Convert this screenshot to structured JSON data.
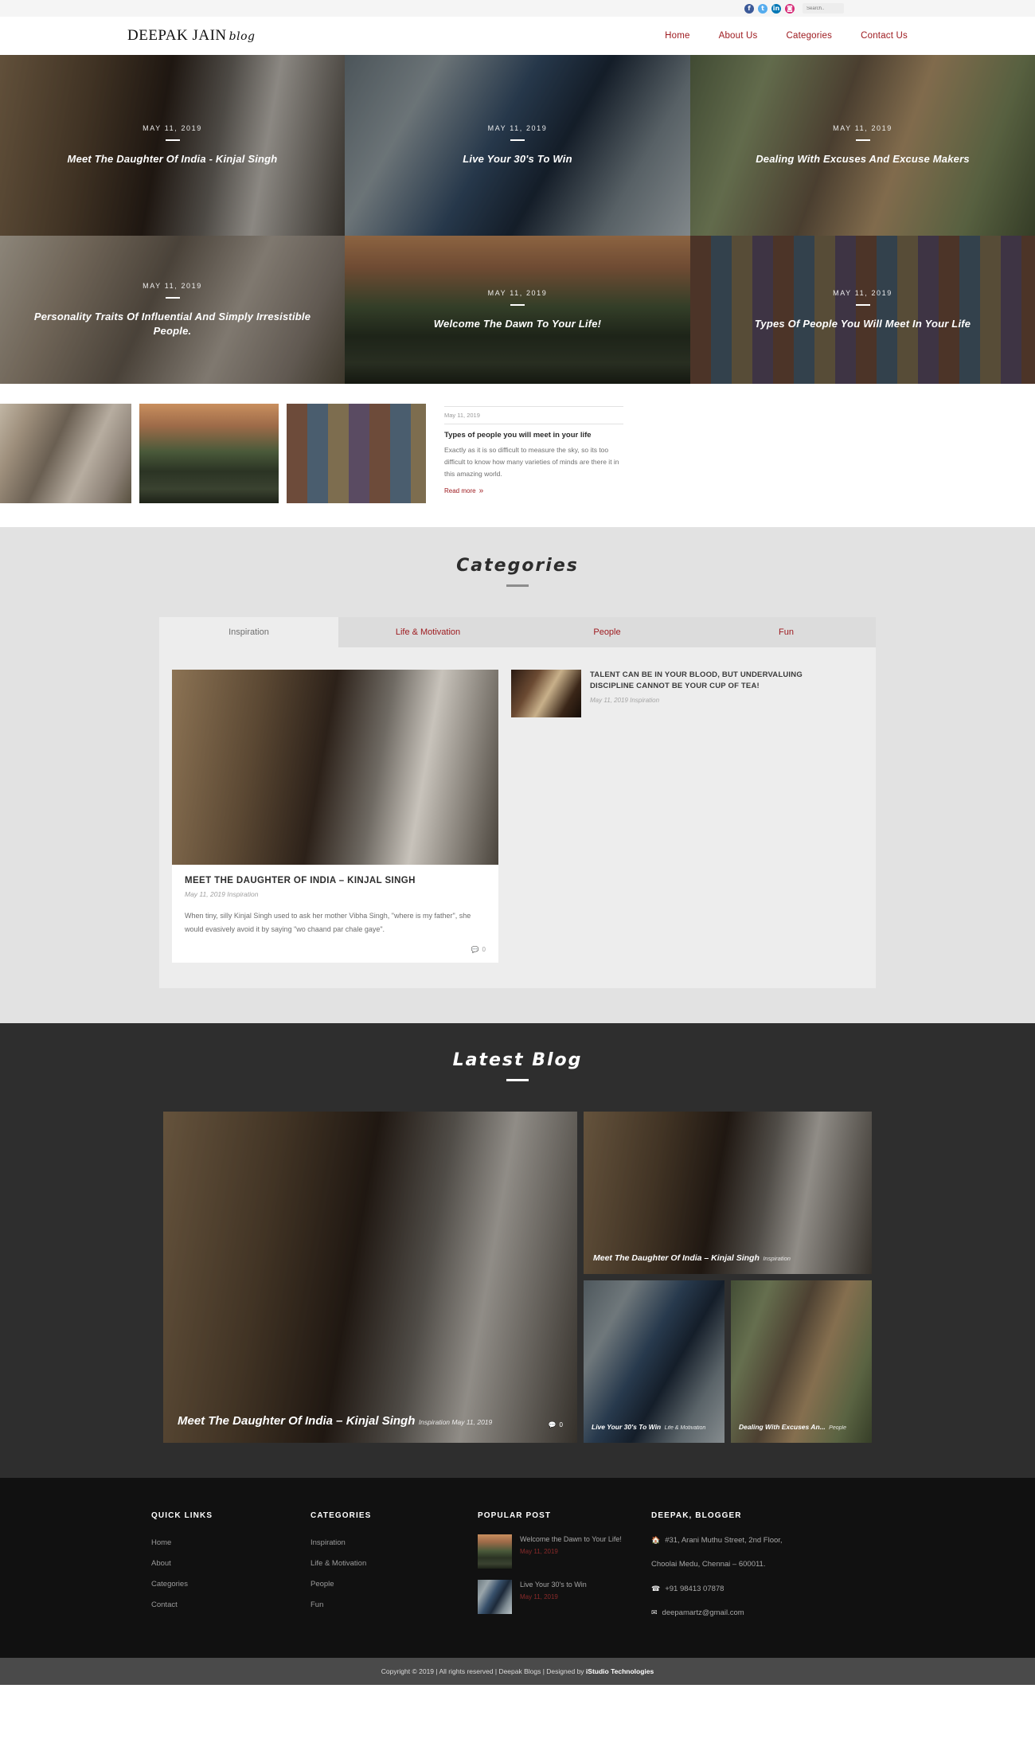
{
  "topbar": {
    "social": [
      {
        "name": "facebook-icon",
        "glyph": "f"
      },
      {
        "name": "twitter-icon",
        "glyph": "t"
      },
      {
        "name": "linkedin-icon",
        "glyph": "in"
      },
      {
        "name": "instagram-icon",
        "glyph": "◙"
      }
    ],
    "search_placeholder": "Search..",
    "search_value": ""
  },
  "nav": {
    "logo": "DEEPAK JAIN",
    "logo_suffix": "blog",
    "links": [
      {
        "label": "Home"
      },
      {
        "label": "About Us"
      },
      {
        "label": "Categories"
      },
      {
        "label": "Contact Us"
      }
    ],
    "accent": "#9e1b20"
  },
  "hero": {
    "tiles": [
      {
        "date": "MAY 11, 2019",
        "title": "Meet The Daughter Of India - Kinjal Singh",
        "img": "img-kinjal"
      },
      {
        "date": "MAY 11, 2019",
        "title": "Live Your 30's To Win",
        "img": "img-30s"
      },
      {
        "date": "MAY 11, 2019",
        "title": "Dealing With Excuses And Excuse Makers",
        "img": "img-excuses"
      },
      {
        "date": "MAY 11, 2019",
        "title": "Personality Traits Of Influential And Simply Irresistible People.",
        "img": "img-person"
      },
      {
        "date": "MAY 11, 2019",
        "title": "Welcome The Dawn To Your Life!",
        "img": "img-dawn"
      },
      {
        "date": "MAY 11, 2019",
        "title": "Types Of People You Will Meet In Your Life",
        "img": "img-types"
      }
    ]
  },
  "strip": {
    "thumbs": [
      "img-person",
      "img-dawn",
      "img-types"
    ],
    "excerpt": {
      "date": "May 11, 2019",
      "title": "Types of people you will meet in your life",
      "body": "Exactly as it is so difficult to measure the sky, so its too difficult to know how many varieties of minds are there it in this amazing world.",
      "read_more": "Read more"
    }
  },
  "categories": {
    "heading": "Categories",
    "tabs": [
      {
        "label": "Inspiration",
        "active": true
      },
      {
        "label": "Life & Motivation",
        "active": false
      },
      {
        "label": "People",
        "active": false
      },
      {
        "label": "Fun",
        "active": false
      }
    ],
    "feature": {
      "img": "img-kinjal",
      "title": "MEET THE DAUGHTER OF INDIA – KINJAL SINGH",
      "meta_date": "May 11, 2019",
      "meta_cat": "Inspiration",
      "excerpt": "When tiny, silly Kinjal Singh used to ask her mother Vibha Singh, \"where is my father\", she would evasively avoid it by saying \"wo chaand par chale gaye\".",
      "comments": "0"
    },
    "side_posts": [
      {
        "img": "img-chess",
        "title": "TALENT CAN BE IN YOUR BLOOD, BUT UNDERVALUING DISCIPLINE CANNOT BE YOUR CUP OF TEA!",
        "meta_date": "May 11, 2019",
        "meta_cat": "Inspiration"
      }
    ]
  },
  "latest": {
    "heading": "Latest Blog",
    "big": {
      "img": "img-kinjal",
      "title": "Meet The Daughter Of India – Kinjal Singh",
      "meta": "Inspiration May 11, 2019",
      "comments": "0"
    },
    "wide": {
      "img": "img-kinjal",
      "title": "Meet The Daughter Of India – Kinjal Singh",
      "meta": "Inspiration"
    },
    "small": [
      {
        "img": "img-30s",
        "title": "Live Your 30's To Win",
        "meta": "Life & Motivation"
      },
      {
        "img": "img-excuses",
        "title": "Dealing With Excuses An...",
        "meta": "People"
      }
    ]
  },
  "footer": {
    "quick_links": {
      "heading": "QUICK LINKS",
      "items": [
        {
          "label": "Home"
        },
        {
          "label": "About"
        },
        {
          "label": "Categories"
        },
        {
          "label": "Contact"
        }
      ]
    },
    "categories": {
      "heading": "CATEGORIES",
      "items": [
        {
          "label": "Inspiration"
        },
        {
          "label": "Life & Motivation"
        },
        {
          "label": "People"
        },
        {
          "label": "Fun"
        }
      ]
    },
    "popular": {
      "heading": "POPULAR POST",
      "items": [
        {
          "img": "img-dawn",
          "title": "Welcome the Dawn to Your Life!",
          "date": "May 11, 2019"
        },
        {
          "img": "img-30s",
          "title": "Live Your 30's to Win",
          "date": "May 11, 2019"
        }
      ]
    },
    "contact": {
      "heading": "DEEPAK, BLOGGER",
      "address_line1": "#31, Arani Muthu Street, 2nd Floor,",
      "address_line2": "Choolai Medu, Chennai – 600011.",
      "phone": "+91 98413 07878",
      "email": "deepamartz@gmail.com",
      "home_icon": "home-icon",
      "phone_icon": "phone-icon",
      "mail_icon": "mail-icon"
    },
    "copyright_text": "Copyright © 2019 | All rights reserved | Deepak Blogs | Designed by ",
    "copyright_brand": "iStudio Technologies"
  }
}
